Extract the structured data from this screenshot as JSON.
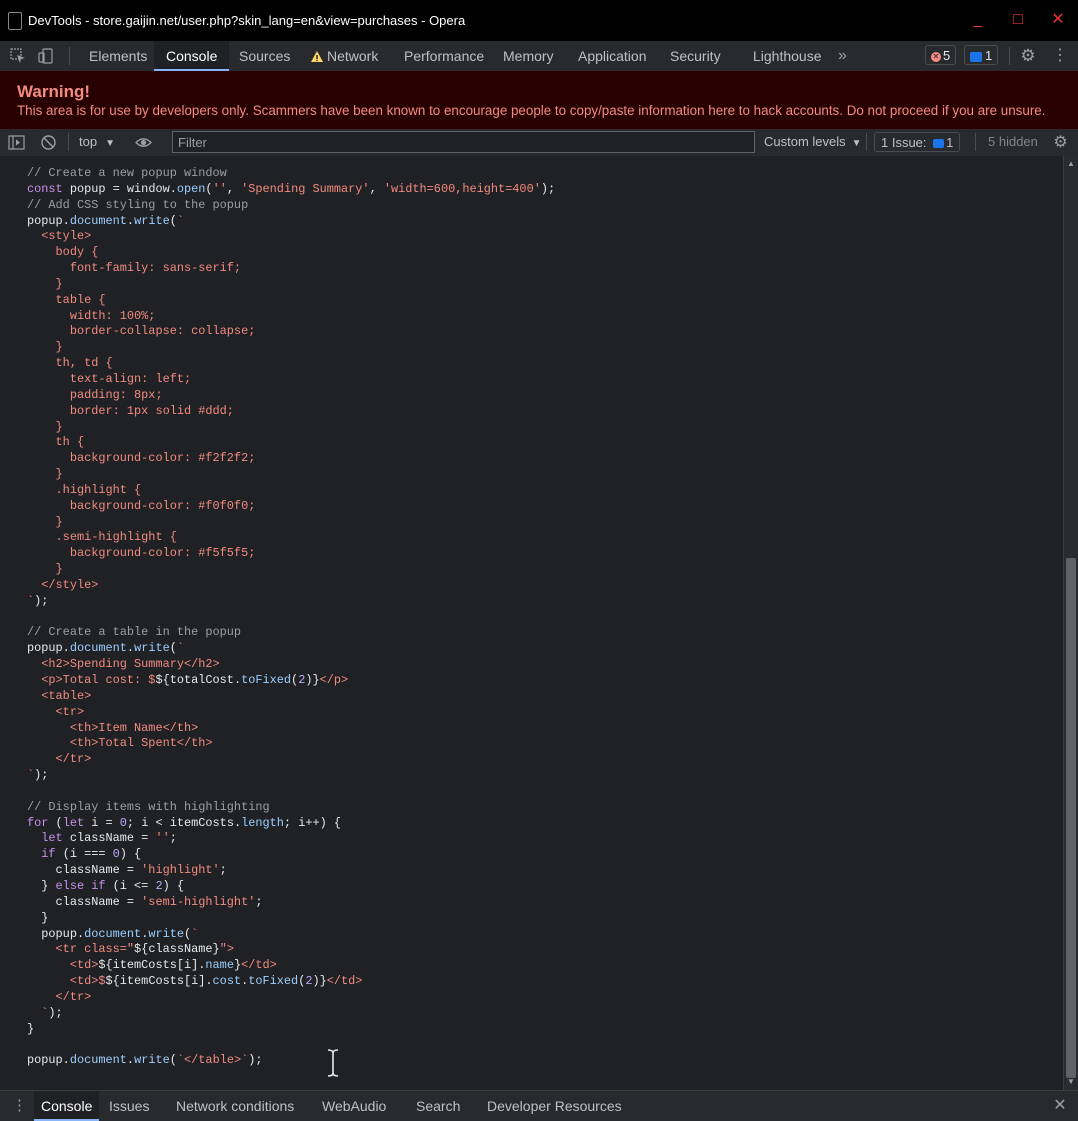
{
  "window": {
    "title": "DevTools - store.gaijin.net/user.php?skin_lang=en&view=purchases - Opera",
    "controls": {
      "minimize": "_",
      "maximize": "□",
      "close": "✕"
    }
  },
  "tabs": [
    {
      "label": "Elements"
    },
    {
      "label": "Console"
    },
    {
      "label": "Sources"
    },
    {
      "label": "Network"
    },
    {
      "label": "Performance"
    },
    {
      "label": "Memory"
    },
    {
      "label": "Application"
    },
    {
      "label": "Security"
    },
    {
      "label": "Lighthouse"
    }
  ],
  "tab_overflow": "»",
  "badges": {
    "errors": "5",
    "messages": "1"
  },
  "warning": {
    "title": "Warning!",
    "text": "This area is for use by developers only. Scammers have been known to encourage people to copy/paste information here to hack accounts. Do not proceed if you are unsure."
  },
  "console_toolbar": {
    "context": "top",
    "filter_placeholder": "Filter",
    "levels": "Custom levels",
    "issues_label": "1 Issue:",
    "issues_count": "1",
    "hidden": "5 hidden"
  },
  "code": {
    "lines": [
      [
        [
          "c",
          "// Create a new popup window"
        ]
      ],
      [
        [
          "k",
          "const "
        ],
        [
          "i",
          "popup = window."
        ],
        [
          "p",
          "open"
        ],
        [
          "i",
          "("
        ],
        [
          "s",
          "''"
        ],
        [
          "i",
          ", "
        ],
        [
          "s",
          "'Spending Summary'"
        ],
        [
          "i",
          ", "
        ],
        [
          "s",
          "'width=600,height=400'"
        ],
        [
          "i",
          ");"
        ]
      ],
      [
        [
          "c",
          "// Add CSS styling to the popup"
        ]
      ],
      [
        [
          "i",
          "popup."
        ],
        [
          "p",
          "document"
        ],
        [
          "i",
          "."
        ],
        [
          "p",
          "write"
        ],
        [
          "i",
          "("
        ],
        [
          "s",
          "`"
        ]
      ],
      [
        [
          "s",
          "  <style>"
        ]
      ],
      [
        [
          "s",
          "    body {"
        ]
      ],
      [
        [
          "s",
          "      font-family: sans-serif;"
        ]
      ],
      [
        [
          "s",
          "    }"
        ]
      ],
      [
        [
          "s",
          "    table {"
        ]
      ],
      [
        [
          "s",
          "      width: 100%;"
        ]
      ],
      [
        [
          "s",
          "      border-collapse: collapse;"
        ]
      ],
      [
        [
          "s",
          "    }"
        ]
      ],
      [
        [
          "s",
          "    th, td {"
        ]
      ],
      [
        [
          "s",
          "      text-align: left;"
        ]
      ],
      [
        [
          "s",
          "      padding: 8px;"
        ]
      ],
      [
        [
          "s",
          "      border: 1px solid #ddd;"
        ]
      ],
      [
        [
          "s",
          "    }"
        ]
      ],
      [
        [
          "s",
          "    th {"
        ]
      ],
      [
        [
          "s",
          "      background-color: #f2f2f2;"
        ]
      ],
      [
        [
          "s",
          "    }"
        ]
      ],
      [
        [
          "s",
          "    .highlight {"
        ]
      ],
      [
        [
          "s",
          "      background-color: #f0f0f0;"
        ]
      ],
      [
        [
          "s",
          "    }"
        ]
      ],
      [
        [
          "s",
          "    .semi-highlight {"
        ]
      ],
      [
        [
          "s",
          "      background-color: #f5f5f5;"
        ]
      ],
      [
        [
          "s",
          "    }"
        ]
      ],
      [
        [
          "s",
          "  </style>"
        ]
      ],
      [
        [
          "s",
          "`"
        ],
        [
          "i",
          ");"
        ]
      ],
      [
        [
          "i",
          ""
        ]
      ],
      [
        [
          "c",
          "// Create a table in the popup"
        ]
      ],
      [
        [
          "i",
          "popup."
        ],
        [
          "p",
          "document"
        ],
        [
          "i",
          "."
        ],
        [
          "p",
          "write"
        ],
        [
          "i",
          "("
        ],
        [
          "s",
          "`"
        ]
      ],
      [
        [
          "s",
          "  <h2>Spending Summary</h2>"
        ]
      ],
      [
        [
          "s",
          "  <p>Total cost: $"
        ],
        [
          "i",
          "${totalCost."
        ],
        [
          "p",
          "toFixed"
        ],
        [
          "i",
          "("
        ],
        [
          "n",
          "2"
        ],
        [
          "i",
          ")}"
        ],
        [
          "s",
          "</p>"
        ]
      ],
      [
        [
          "s",
          "  <table>"
        ]
      ],
      [
        [
          "s",
          "    <tr>"
        ]
      ],
      [
        [
          "s",
          "      <th>Item Name</th>"
        ]
      ],
      [
        [
          "s",
          "      <th>Total Spent</th>"
        ]
      ],
      [
        [
          "s",
          "    </tr>"
        ]
      ],
      [
        [
          "s",
          "`"
        ],
        [
          "i",
          ");"
        ]
      ],
      [
        [
          "i",
          ""
        ]
      ],
      [
        [
          "c",
          "// Display items with highlighting"
        ]
      ],
      [
        [
          "k",
          "for "
        ],
        [
          "i",
          "("
        ],
        [
          "k",
          "let "
        ],
        [
          "i",
          "i = "
        ],
        [
          "n",
          "0"
        ],
        [
          "i",
          "; i < itemCosts."
        ],
        [
          "p",
          "length"
        ],
        [
          "i",
          "; i++) {"
        ]
      ],
      [
        [
          "k",
          "  let "
        ],
        [
          "i",
          "className = "
        ],
        [
          "s",
          "''"
        ],
        [
          "i",
          ";"
        ]
      ],
      [
        [
          "k",
          "  if "
        ],
        [
          "i",
          "(i === "
        ],
        [
          "n",
          "0"
        ],
        [
          "i",
          ") {"
        ]
      ],
      [
        [
          "i",
          "    className = "
        ],
        [
          "s",
          "'highlight'"
        ],
        [
          "i",
          ";"
        ]
      ],
      [
        [
          "i",
          "  } "
        ],
        [
          "k",
          "else if "
        ],
        [
          "i",
          "(i <= "
        ],
        [
          "n",
          "2"
        ],
        [
          "i",
          ") {"
        ]
      ],
      [
        [
          "i",
          "    className = "
        ],
        [
          "s",
          "'semi-highlight'"
        ],
        [
          "i",
          ";"
        ]
      ],
      [
        [
          "i",
          "  }"
        ]
      ],
      [
        [
          "i",
          "  popup."
        ],
        [
          "p",
          "document"
        ],
        [
          "i",
          "."
        ],
        [
          "p",
          "write"
        ],
        [
          "i",
          "("
        ],
        [
          "s",
          "`"
        ]
      ],
      [
        [
          "s",
          "    <tr class=\""
        ],
        [
          "i",
          "${className}"
        ],
        [
          "s",
          "\">"
        ]
      ],
      [
        [
          "s",
          "      <td>"
        ],
        [
          "i",
          "${itemCosts[i]."
        ],
        [
          "p",
          "name"
        ],
        [
          "i",
          "}"
        ],
        [
          "s",
          "</td>"
        ]
      ],
      [
        [
          "s",
          "      <td>$"
        ],
        [
          "i",
          "${itemCosts[i]."
        ],
        [
          "p",
          "cost"
        ],
        [
          "i",
          "."
        ],
        [
          "p",
          "toFixed"
        ],
        [
          "i",
          "("
        ],
        [
          "n",
          "2"
        ],
        [
          "i",
          ")}"
        ],
        [
          "s",
          "</td>"
        ]
      ],
      [
        [
          "s",
          "    </tr>"
        ]
      ],
      [
        [
          "s",
          "  `"
        ],
        [
          "i",
          ");"
        ]
      ],
      [
        [
          "i",
          "}"
        ]
      ],
      [
        [
          "i",
          ""
        ]
      ],
      [
        [
          "i",
          "popup."
        ],
        [
          "p",
          "document"
        ],
        [
          "i",
          "."
        ],
        [
          "p",
          "write"
        ],
        [
          "i",
          "("
        ],
        [
          "s",
          "`</table>`"
        ],
        [
          "i",
          ");"
        ]
      ]
    ]
  },
  "drawer": {
    "tabs": [
      {
        "label": "Console"
      },
      {
        "label": "Issues"
      },
      {
        "label": "Network conditions"
      },
      {
        "label": "WebAudio"
      },
      {
        "label": "Search"
      },
      {
        "label": "Developer Resources"
      }
    ]
  },
  "colors": {
    "background": "#202124",
    "warning_bg": "#290000",
    "warning_text": "#f28b82",
    "accent": "#8ab4f8",
    "close_red": "#e8322f"
  }
}
